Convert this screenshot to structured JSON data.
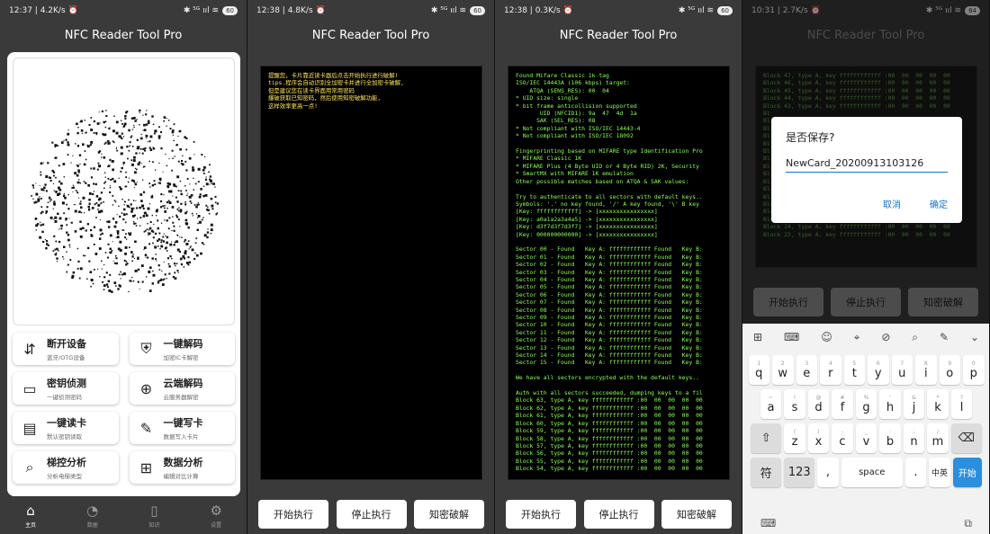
{
  "app_title": "NFC Reader Tool Pro",
  "screens": [
    {
      "time": "12:37 | 4.2K/s ⏰",
      "battery": "60"
    },
    {
      "time": "12:38 | 4.8K/s ⏰",
      "battery": "60"
    },
    {
      "time": "12:38 | 0.3K/s ⏰",
      "battery": "60"
    },
    {
      "time": "10:31 | 2.7K/s ⏰",
      "battery": "84"
    }
  ],
  "status_icons": "✱ ⁵ᴳ ııl ≋",
  "home": {
    "buttons": [
      {
        "title": "断开设备",
        "sub": "蓝牙/OTG设备",
        "icon": "disconnect-icon",
        "glyph": "⇵"
      },
      {
        "title": "一键解码",
        "sub": "加密IC卡解密",
        "icon": "shield-check-icon",
        "glyph": "⛨"
      },
      {
        "title": "密钥侦测",
        "sub": "一键侦测密码",
        "icon": "card-icon",
        "glyph": "▭"
      },
      {
        "title": "云端解码",
        "sub": "云服务器解密",
        "icon": "globe-icon",
        "glyph": "⊕"
      },
      {
        "title": "一键读卡",
        "sub": "默认密钥读取",
        "icon": "read-card-icon",
        "glyph": "▤"
      },
      {
        "title": "一键写卡",
        "sub": "数据写入卡片",
        "icon": "write-card-icon",
        "glyph": "✎"
      },
      {
        "title": "梯控分析",
        "sub": "分析电梯类型",
        "icon": "elevator-analysis-icon",
        "glyph": "⌕"
      },
      {
        "title": "数据分析",
        "sub": "编辑对比计算",
        "icon": "grid-icon",
        "glyph": "⊞"
      }
    ],
    "nav": [
      {
        "label": "主页",
        "icon": "home-icon",
        "glyph": "⌂"
      },
      {
        "label": "数据",
        "icon": "pie-icon",
        "glyph": "◔"
      },
      {
        "label": "知识",
        "icon": "book-icon",
        "glyph": "▯"
      },
      {
        "label": "设置",
        "icon": "settings-icon",
        "glyph": "⚙"
      }
    ]
  },
  "screen2": {
    "log": "提醒您，卡片靠近读卡器后点击开始执行进行破解!\ntips.程序会自动识别全加密卡并进行全加密卡破解,\n但是建议您在读卡界面用常用密码\n爆破获取已知密码，然后使用知密破解功能,\n这样效率更高一点!"
  },
  "screen3": {
    "log": "Found Mifare Classic 1k tag\nISO/IEC 14443A (106 kbps) target:\n    ATQA (SENS_RES): 00  04\n* UID size: single\n* bit frame anticollision supported\n       UID (NFCID1): 9a  47  4d  1a\n      SAK (SEL_RES): 08\n* Not compliant with ISO/IEC 14443-4\n* Not compliant with ISO/IEC 18092\n\nFingerprinting based on MIFARE type Identification Pro\n* MIFARE Classic 1K\n* MIFARE Plus (4 Byte UID or 4 Byte RID) 2K, Security\n* SmartMX with MIFARE 1K emulation\nOther possible matches based on ATQA & SAK values:\n\nTry to authenticate to all sectors with default keys..\nSymbols: '.' no key found, '/' A key found, '\\' B key\n[Key: ffffffffffff] -> [xxxxxxxxxxxxxxxx]\n[Key: a0a1a2a3a4a5] -> [xxxxxxxxxxxxxxxx]\n[Key: d3f7d3f7d3f7] -> [xxxxxxxxxxxxxxxx]\n[Key: 000000000000] -> [xxxxxxxxxxxxxxxx]\n\nSector 00 - Found   Key A: ffffffffffff Found   Key B:\nSector 01 - Found   Key A: ffffffffffff Found   Key B:\nSector 02 - Found   Key A: ffffffffffff Found   Key B:\nSector 03 - Found   Key A: ffffffffffff Found   Key B:\nSector 04 - Found   Key A: ffffffffffff Found   Key B:\nSector 05 - Found   Key A: ffffffffffff Found   Key B:\nSector 06 - Found   Key A: ffffffffffff Found   Key B:\nSector 07 - Found   Key A: ffffffffffff Found   Key B:\nSector 08 - Found   Key A: ffffffffffff Found   Key B:\nSector 09 - Found   Key A: ffffffffffff Found   Key B:\nSector 10 - Found   Key A: ffffffffffff Found   Key B:\nSector 11 - Found   Key A: ffffffffffff Found   Key B:\nSector 12 - Found   Key A: ffffffffffff Found   Key B:\nSector 13 - Found   Key A: ffffffffffff Found   Key B:\nSector 14 - Found   Key A: ffffffffffff Found   Key B:\nSector 15 - Found   Key A: ffffffffffff Found   Key B:\n\nWe have all sectors encrypted with the default keys..\n\nAuth with all sectors succeeded, dumping keys to a fil\nBlock 63, type A, key ffffffffffff :00  00  00  00  00\nBlock 62, type A, key ffffffffffff :00  00  00  00  00\nBlock 61, type A, key ffffffffffff :00  00  00  00  00\nBlock 60, type A, key ffffffffffff :00  00  00  00  00\nBlock 59, type A, key ffffffffffff :00  00  00  00  00\nBlock 58, type A, key ffffffffffff :00  00  00  00  00\nBlock 57, type A, key ffffffffffff :00  00  00  00  00\nBlock 56, type A, key ffffffffffff :00  00  00  00  00\nBlock 55, type A, key ffffffffffff :00  00  00  00  00\nBlock 54, type A, key ffffffffffff :00  00  00  00  00"
  },
  "screen4": {
    "log": "Block 47, type A, key ffffffffffff :00  00  00  00  00\nBlock 46, type A, key ffffffffffff :00  00  00  00  00\nBlock 45, type A, key ffffffffffff :00  00  00  00  00\nBlock 44, type A, key ffffffffffff :00  00  00  00  00\nBlock 43, type A, key ffffffffffff :00  00  00  00  00\nBl\nBl\nBl\nBl\nBl\nBl\nBl\nBl\nBl\nBl\nBl\nBl\nBlock 27, type A, key ffffffffffff :00  00  00  00  00\nBlock 26, type A, key ffffffffffff :00  00  00  00  00\nBlock 25, type A, key ffffffffffff :00  00  00  00  00\nBlock 24, type A, key ffffffffffff :00  00  00  00  00\nBlock 23, type A, key ffffffffffff :00  00  00  00  00",
    "dialog": {
      "title": "是否保存?",
      "value": "NewCard_20200913103126",
      "cancel": "取消",
      "ok": "确定"
    },
    "kb_row1": [
      [
        "q",
        "1"
      ],
      [
        "w",
        "2"
      ],
      [
        "e",
        "3"
      ],
      [
        "r",
        "4"
      ],
      [
        "t",
        "5"
      ],
      [
        "y",
        "6"
      ],
      [
        "u",
        "7"
      ],
      [
        "i",
        "8"
      ],
      [
        "o",
        "9"
      ],
      [
        "p",
        "0"
      ]
    ],
    "kb_row2": [
      [
        "a",
        "~"
      ],
      [
        "s",
        "!"
      ],
      [
        "d",
        "@"
      ],
      [
        "f",
        "#"
      ],
      [
        "g",
        "%"
      ],
      [
        "h",
        "'"
      ],
      [
        "j",
        "&"
      ],
      [
        "k",
        "*"
      ],
      [
        "l",
        "?"
      ]
    ],
    "kb_row3": [
      [
        "z",
        "("
      ],
      [
        "x",
        ")"
      ],
      [
        "c",
        "-"
      ],
      [
        "v",
        "_"
      ],
      [
        "b",
        ":"
      ],
      [
        "n",
        ";"
      ],
      [
        "m",
        "/"
      ]
    ],
    "kb_fn": {
      "sym": "符",
      "num": "123",
      "comma": ",",
      "space": "space",
      "dot": ".",
      "lang": "中英",
      "go": "开始",
      "shift": "⇧",
      "del": "⌫"
    },
    "kb_tools": [
      "⊞",
      "⌨",
      "☺",
      "⌖",
      "⊘",
      "⌕",
      "✎",
      "⌄"
    ]
  },
  "actions": {
    "start": "开始执行",
    "stop": "停止执行",
    "crack": "知密破解"
  }
}
